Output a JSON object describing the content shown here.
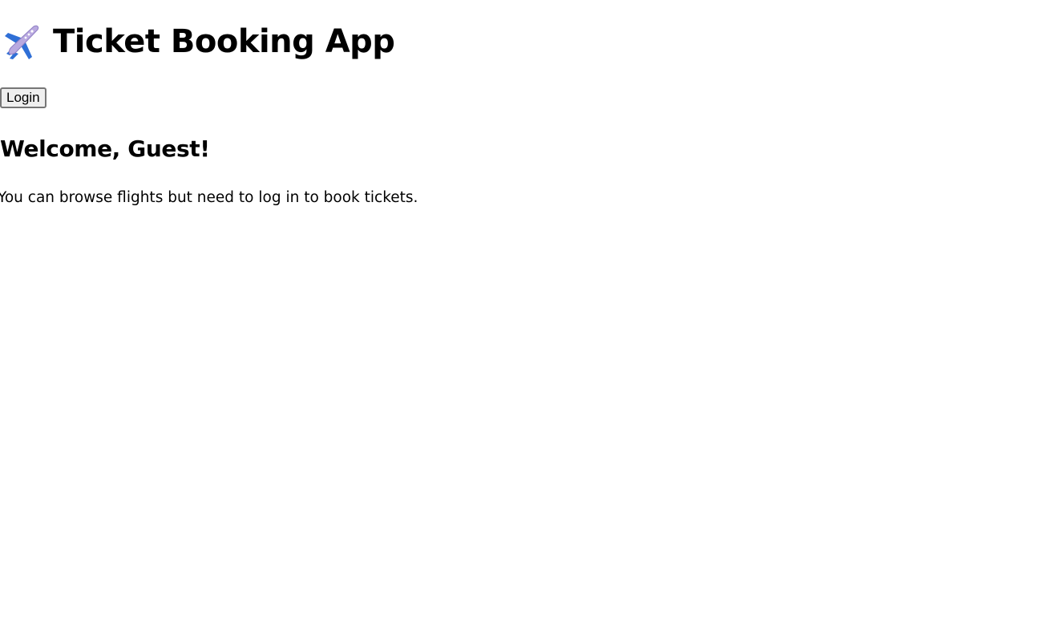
{
  "header": {
    "icon": "airplane-icon",
    "title": "Ticket Booking App"
  },
  "auth": {
    "login_label": "Login"
  },
  "main": {
    "welcome": "Welcome, Guest!",
    "info": "You can browse flights but need to log in to book tickets."
  },
  "colors": {
    "text": "#000000",
    "background": "#ffffff",
    "button_bg": "#efefef",
    "button_border": "#767676",
    "icon_blue": "#2f6fd6",
    "icon_lavender": "#b9a9e0"
  }
}
